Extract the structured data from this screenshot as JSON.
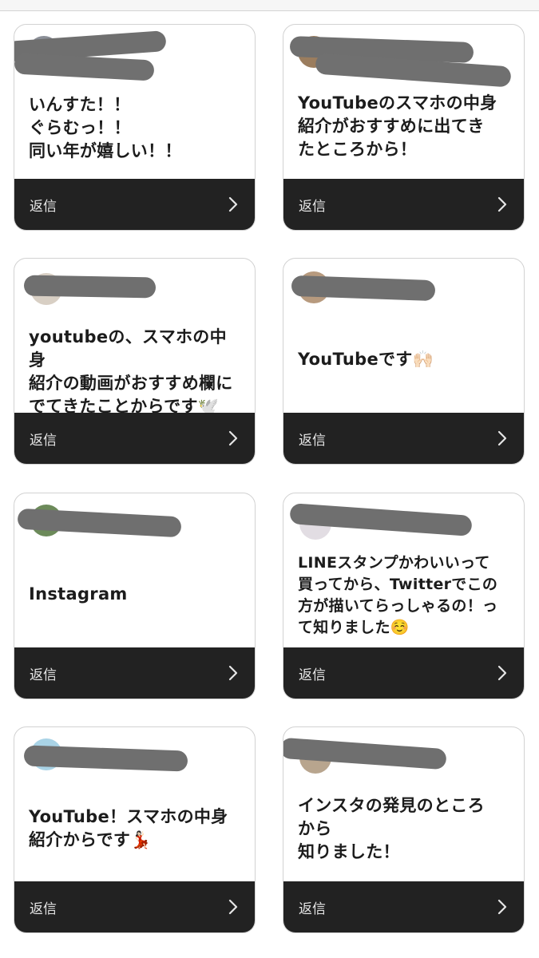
{
  "reply_label": "返信",
  "cards": [
    {
      "message": "いんすた！！\nぐらむっ！！\n同い年が嬉しい！！"
    },
    {
      "message": "YouTubeのスマホの中身\n紹介がおすすめに出てき\nたところから！"
    },
    {
      "message": "youtubeの、スマホの中身\n紹介の動画がおすすめ欄に\nでてきたことからです🕊️"
    },
    {
      "message": "YouTubeです🙌🏻"
    },
    {
      "message": "Instagram"
    },
    {
      "message": "LINEスタンプかわいいって\n買ってから、Twitterでこの\n方が描いてらっしゃるの！っ\nて知りました☺️"
    },
    {
      "message": "YouTube！スマホの中身\n紹介からです💃🏻"
    },
    {
      "message": "インスタの発見のところ\nから\n知りました！"
    }
  ],
  "icons": {
    "reply_arrow": "chevron-right-icon"
  }
}
